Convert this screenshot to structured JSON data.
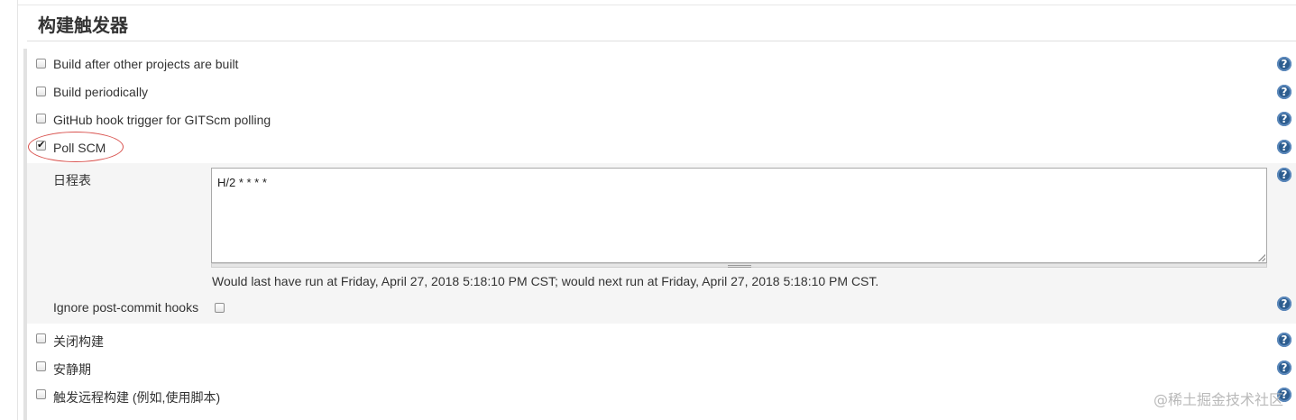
{
  "section": {
    "title": "构建触发器"
  },
  "triggers": [
    {
      "label": "Build after other projects are built",
      "checked": false
    },
    {
      "label": "Build periodically",
      "checked": false
    },
    {
      "label": "GitHub hook trigger for GITScm polling",
      "checked": false
    },
    {
      "label": "Poll SCM",
      "checked": true
    }
  ],
  "poll_scm": {
    "schedule_label": "日程表",
    "schedule_value": "H/2 * * * *",
    "schedule_hint": "Would last have run at Friday, April 27, 2018 5:18:10 PM CST; would next run at Friday, April 27, 2018 5:18:10 PM CST.",
    "ignore_hooks_label": "Ignore post-commit hooks",
    "ignore_hooks_checked": false
  },
  "more_triggers": [
    {
      "label": "关闭构建",
      "checked": false
    },
    {
      "label": "安静期",
      "checked": false
    },
    {
      "label": "触发远程构建 (例如,使用脚本)",
      "checked": false
    }
  ],
  "help_icon_glyph": "?",
  "watermark": "@稀土掘金技术社区",
  "colors": {
    "help": "#2d5d8f",
    "highlight_circle": "#d9534f",
    "nested_bg": "#f5f5f5"
  }
}
